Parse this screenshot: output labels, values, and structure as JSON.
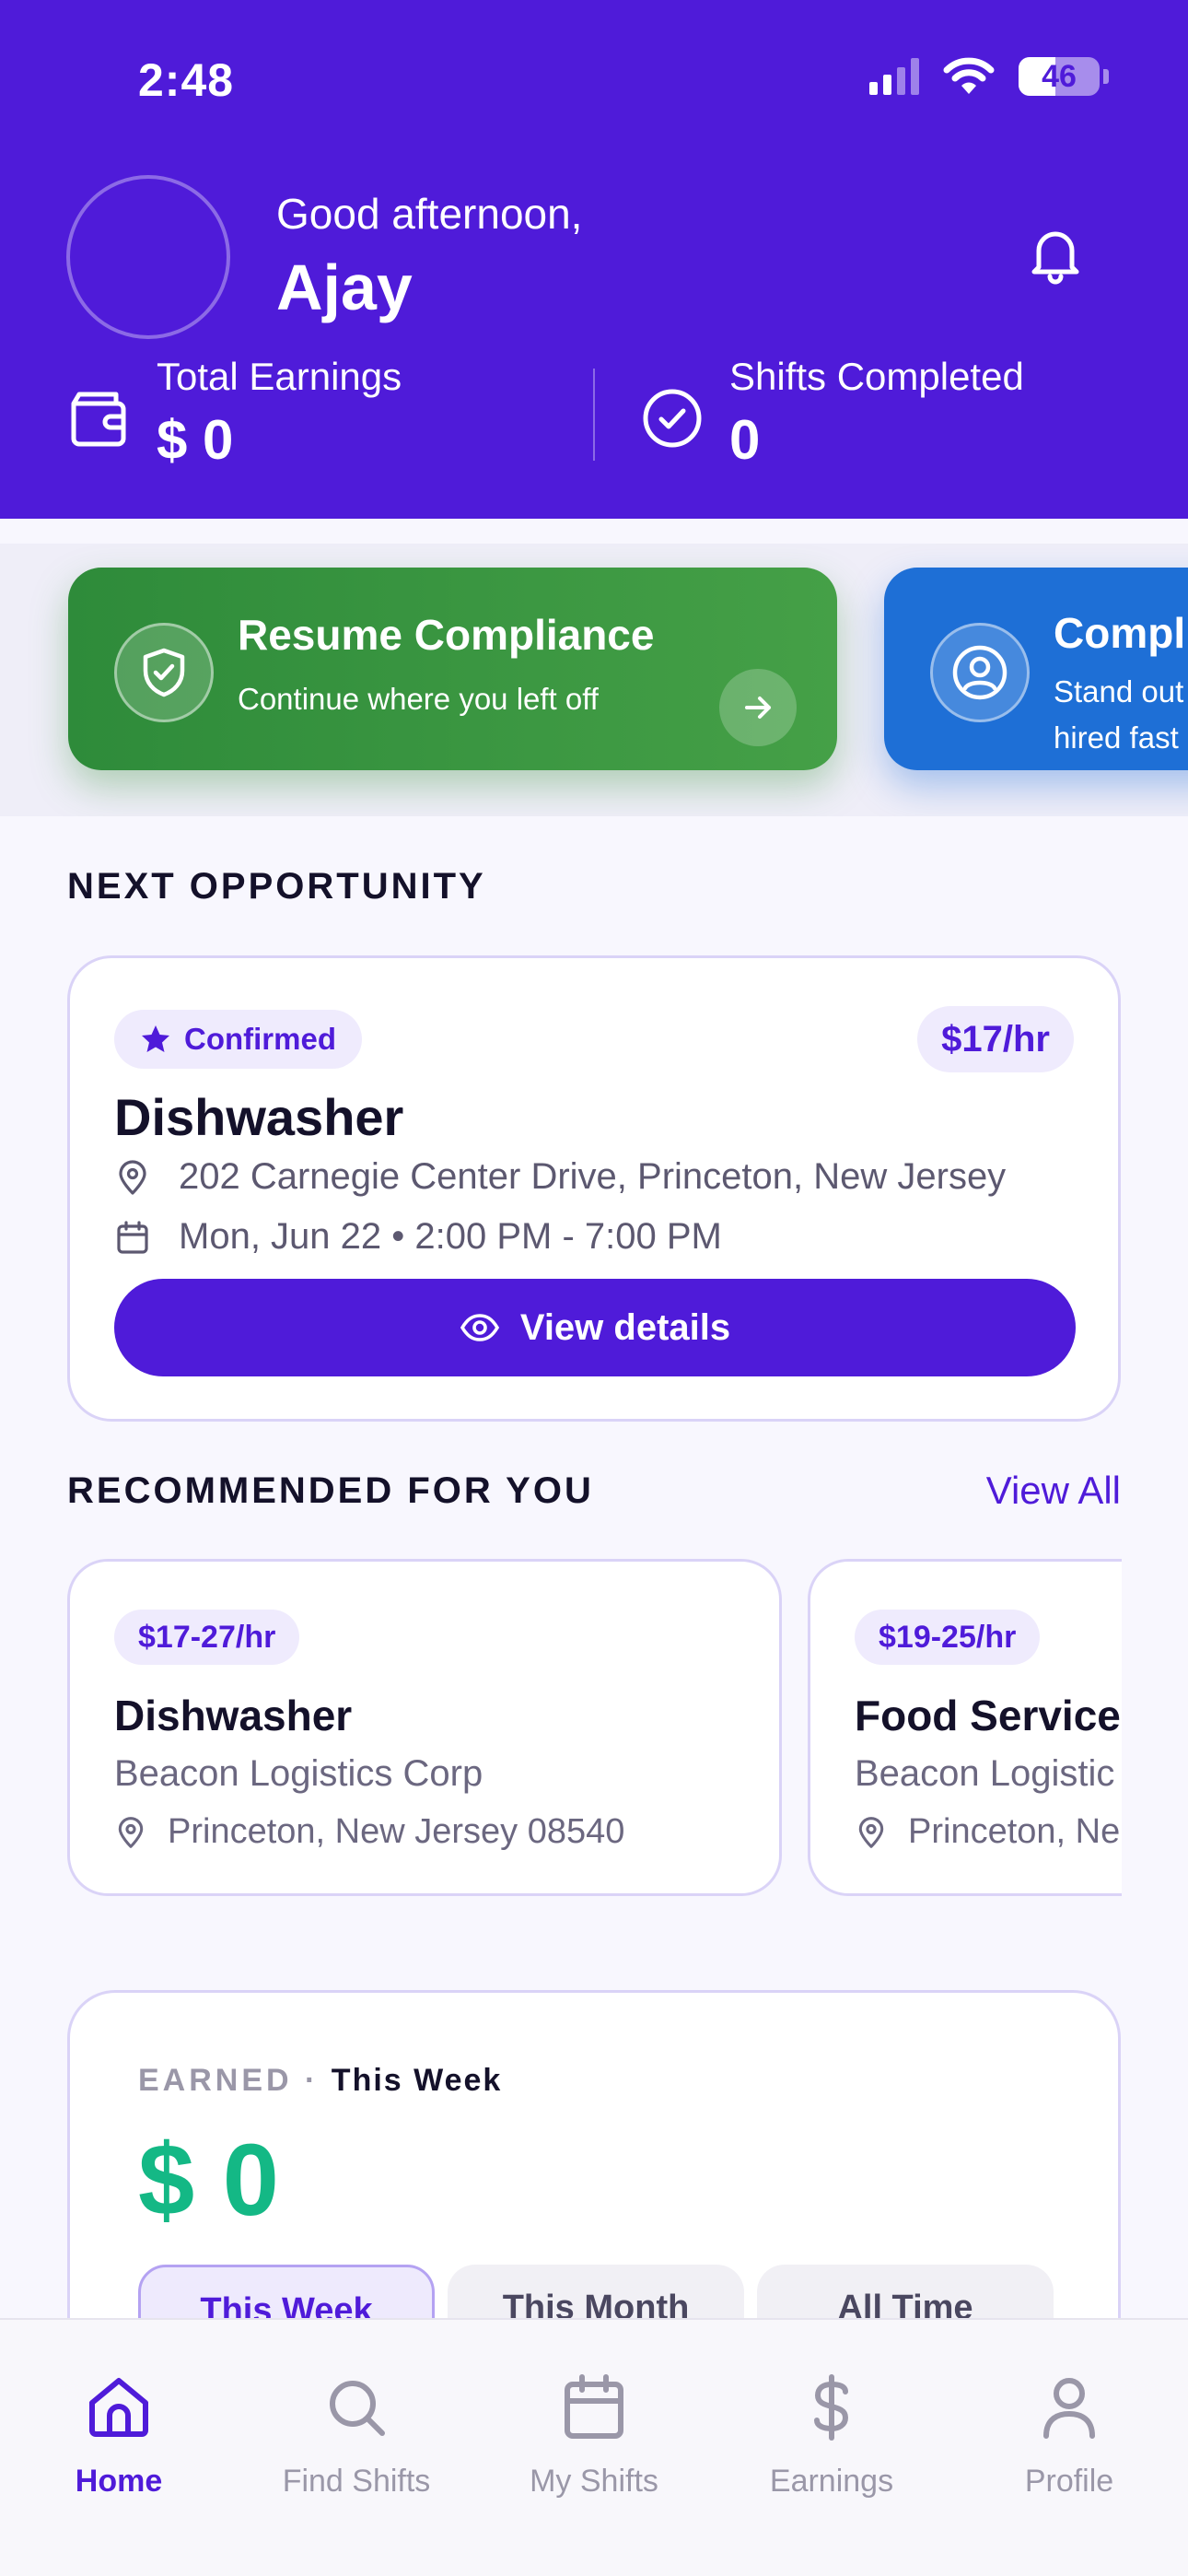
{
  "status_bar": {
    "time": "2:48",
    "battery": "46"
  },
  "header": {
    "greeting": "Good afternoon,",
    "user_name": "Ajay",
    "stats": [
      {
        "label": "Total Earnings",
        "value": "$ 0"
      },
      {
        "label": "Shifts Completed",
        "value": "0"
      }
    ]
  },
  "promos": [
    {
      "title": "Resume Compliance",
      "subtitle": "Continue where you left off",
      "color": "#3C963F"
    },
    {
      "title": "Compl",
      "subtitle": "Stand out",
      "subtitle2": "hired fast",
      "color": "#1E6FD6"
    }
  ],
  "next_opportunity": {
    "section_title": "NEXT OPPORTUNITY",
    "status": "Confirmed",
    "rate": "$17/hr",
    "title": "Dishwasher",
    "address": "202 Carnegie Center Drive, Princeton, New Jersey",
    "schedule": "Mon, Jun 22 • 2:00 PM - 7:00 PM",
    "button_label": "View details"
  },
  "recommended": {
    "section_title": "RECOMMENDED FOR YOU",
    "view_all": "View All",
    "items": [
      {
        "rate": "$17-27/hr",
        "title": "Dishwasher",
        "company": "Beacon Logistics Corp",
        "location": "Princeton, New Jersey 08540"
      },
      {
        "rate": "$19-25/hr",
        "title": "Food Service",
        "company": "Beacon Logistic",
        "location": "Princeton, Ne"
      }
    ]
  },
  "earned": {
    "label": "EARNED",
    "period": "This Week",
    "value": "$ 0",
    "tabs": [
      "This Week",
      "This Month",
      "All Time"
    ],
    "active_tab": "This Week"
  },
  "nav": {
    "items": [
      {
        "label": "Home",
        "icon": "home-icon",
        "active": true
      },
      {
        "label": "Find Shifts",
        "icon": "search-icon",
        "active": false
      },
      {
        "label": "My Shifts",
        "icon": "calendar-icon",
        "active": false
      },
      {
        "label": "Earnings",
        "icon": "dollar-icon",
        "active": false
      },
      {
        "label": "Profile",
        "icon": "person-icon",
        "active": false
      }
    ]
  },
  "colors": {
    "primary": "#4F1BD9",
    "success": "#14B885"
  }
}
